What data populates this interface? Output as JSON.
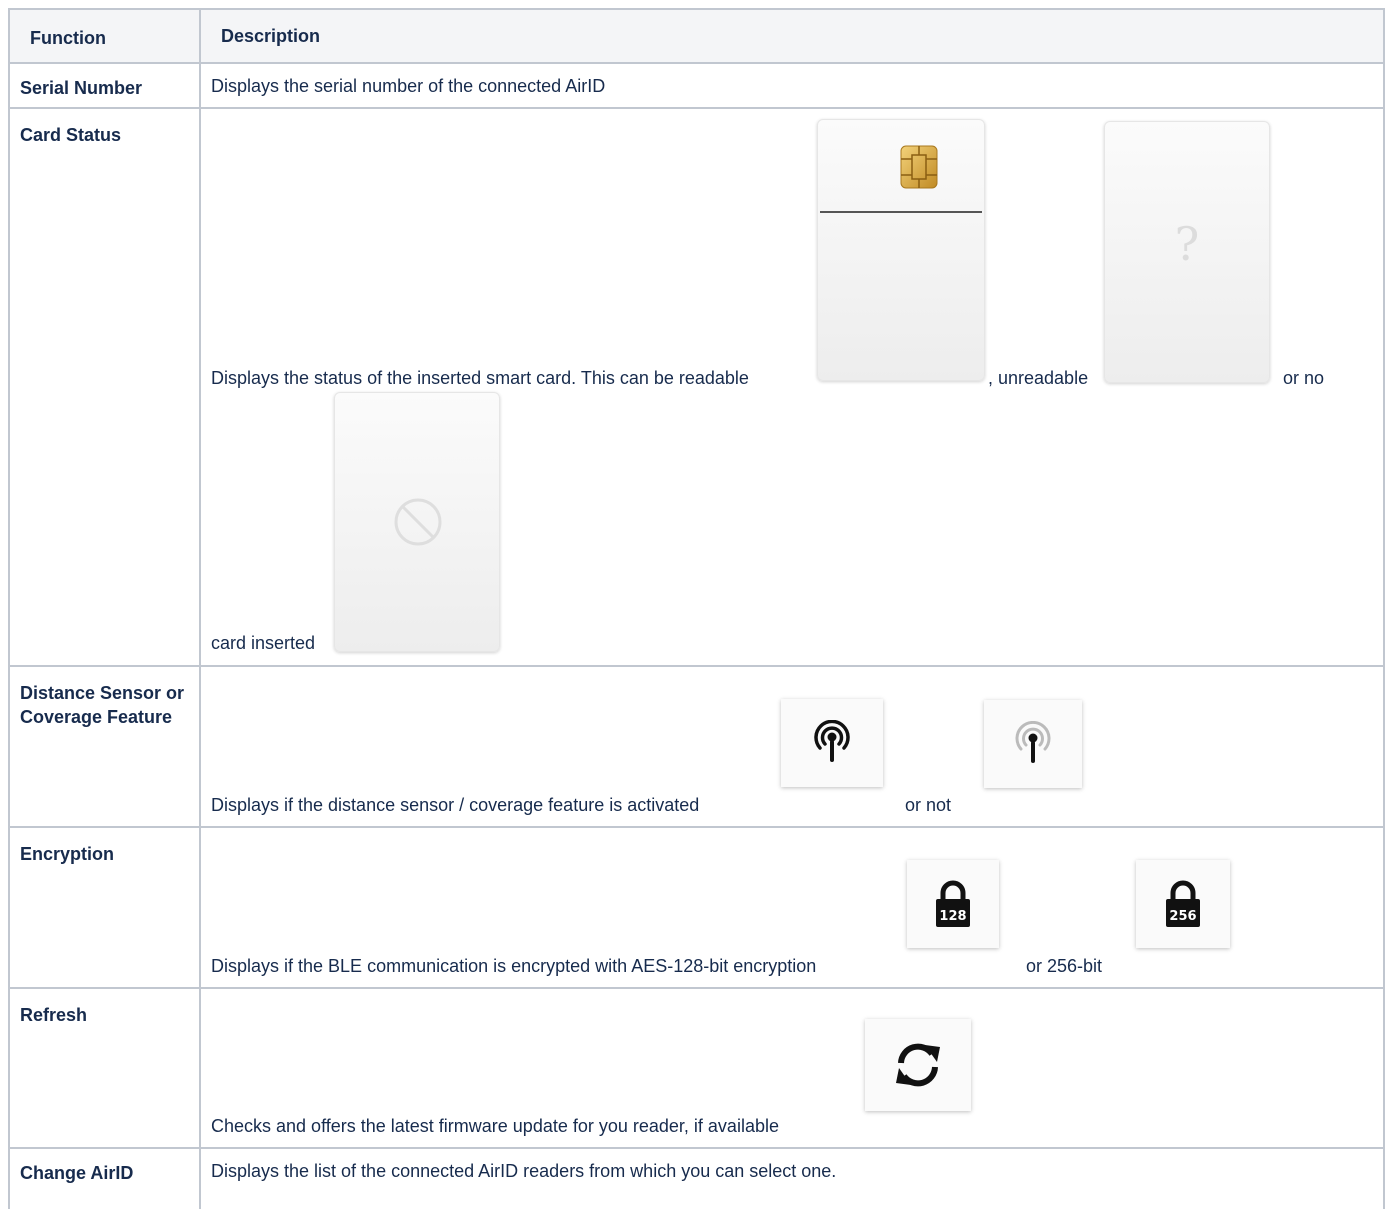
{
  "table": {
    "headers": {
      "function": "Function",
      "description": "Description"
    },
    "rows": [
      {
        "function": "Serial Number",
        "description": "Displays the serial number of the connected AirID"
      },
      {
        "function": "Card Status",
        "description_parts": [
          "Displays the status of the inserted smart card. This can be readable",
          ", unreadable",
          "or no",
          "card inserted"
        ],
        "icons": [
          "smart-card-readable-icon",
          "smart-card-unreadable-icon",
          "no-card-inserted-icon"
        ]
      },
      {
        "function": "Distance Sensor or Coverage Feature",
        "description_parts": [
          "Displays if the distance sensor / coverage feature is activated",
          "or not"
        ],
        "icons": [
          "coverage-activated-icon",
          "coverage-deactivated-icon"
        ]
      },
      {
        "function": "Encryption",
        "description_parts": [
          "Displays if the BLE communication is encrypted with AES-128-bit encryption",
          "or 256-bit"
        ],
        "icons": [
          "lock-128-icon",
          "lock-256-icon"
        ],
        "icon_labels": [
          "128",
          "256"
        ]
      },
      {
        "function": "Refresh",
        "description": "Checks and offers the latest firmware update for you reader, if available",
        "icons": [
          "refresh-icon"
        ]
      },
      {
        "function": "Change AirID",
        "description": "Displays the list of the connected AirID readers from which you can select one."
      }
    ]
  },
  "colors": {
    "border": "#c1c7d0",
    "header_bg": "#f4f5f7",
    "text": "#172b4d"
  }
}
